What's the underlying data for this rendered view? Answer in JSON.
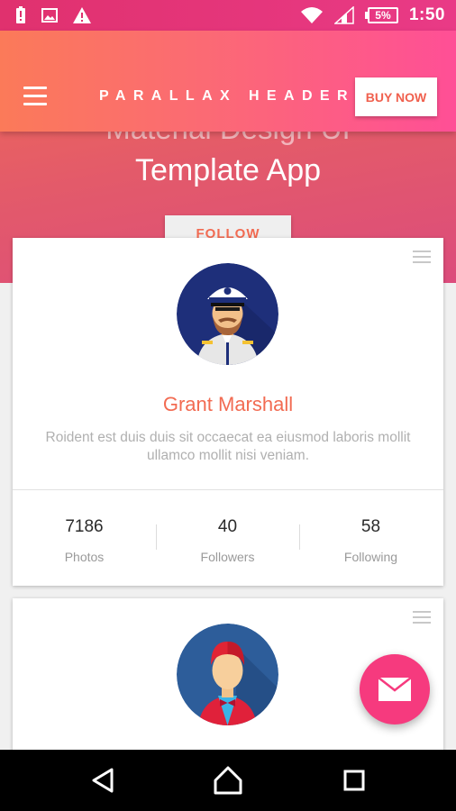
{
  "status_bar": {
    "time": "1:50",
    "battery": "5%",
    "icons_left": [
      "battery-alert-icon",
      "image-icon",
      "warning-icon"
    ],
    "icons_right": [
      "wifi-icon",
      "signal-icon",
      "battery-icon"
    ]
  },
  "toolbar": {
    "title": "PARALLAX HEADER",
    "buy_label": "BUY NOW"
  },
  "hero": {
    "faded_text": "Material Design UI",
    "title": "Template App",
    "follow_label": "FOLLOW"
  },
  "profile": {
    "name": "Grant Marshall",
    "bio": "Roident est duis duis sit occaecat ea eiusmod laboris mollit ullamco mollit nisi veniam.",
    "stats": [
      {
        "value": "7186",
        "label": "Photos"
      },
      {
        "value": "40",
        "label": "Followers"
      },
      {
        "value": "58",
        "label": "Following"
      }
    ]
  },
  "colors": {
    "accent": "#f26b52",
    "toolbar_start": "#fb7a59",
    "toolbar_end": "#ff4f96",
    "fab": "#f63a7e"
  }
}
